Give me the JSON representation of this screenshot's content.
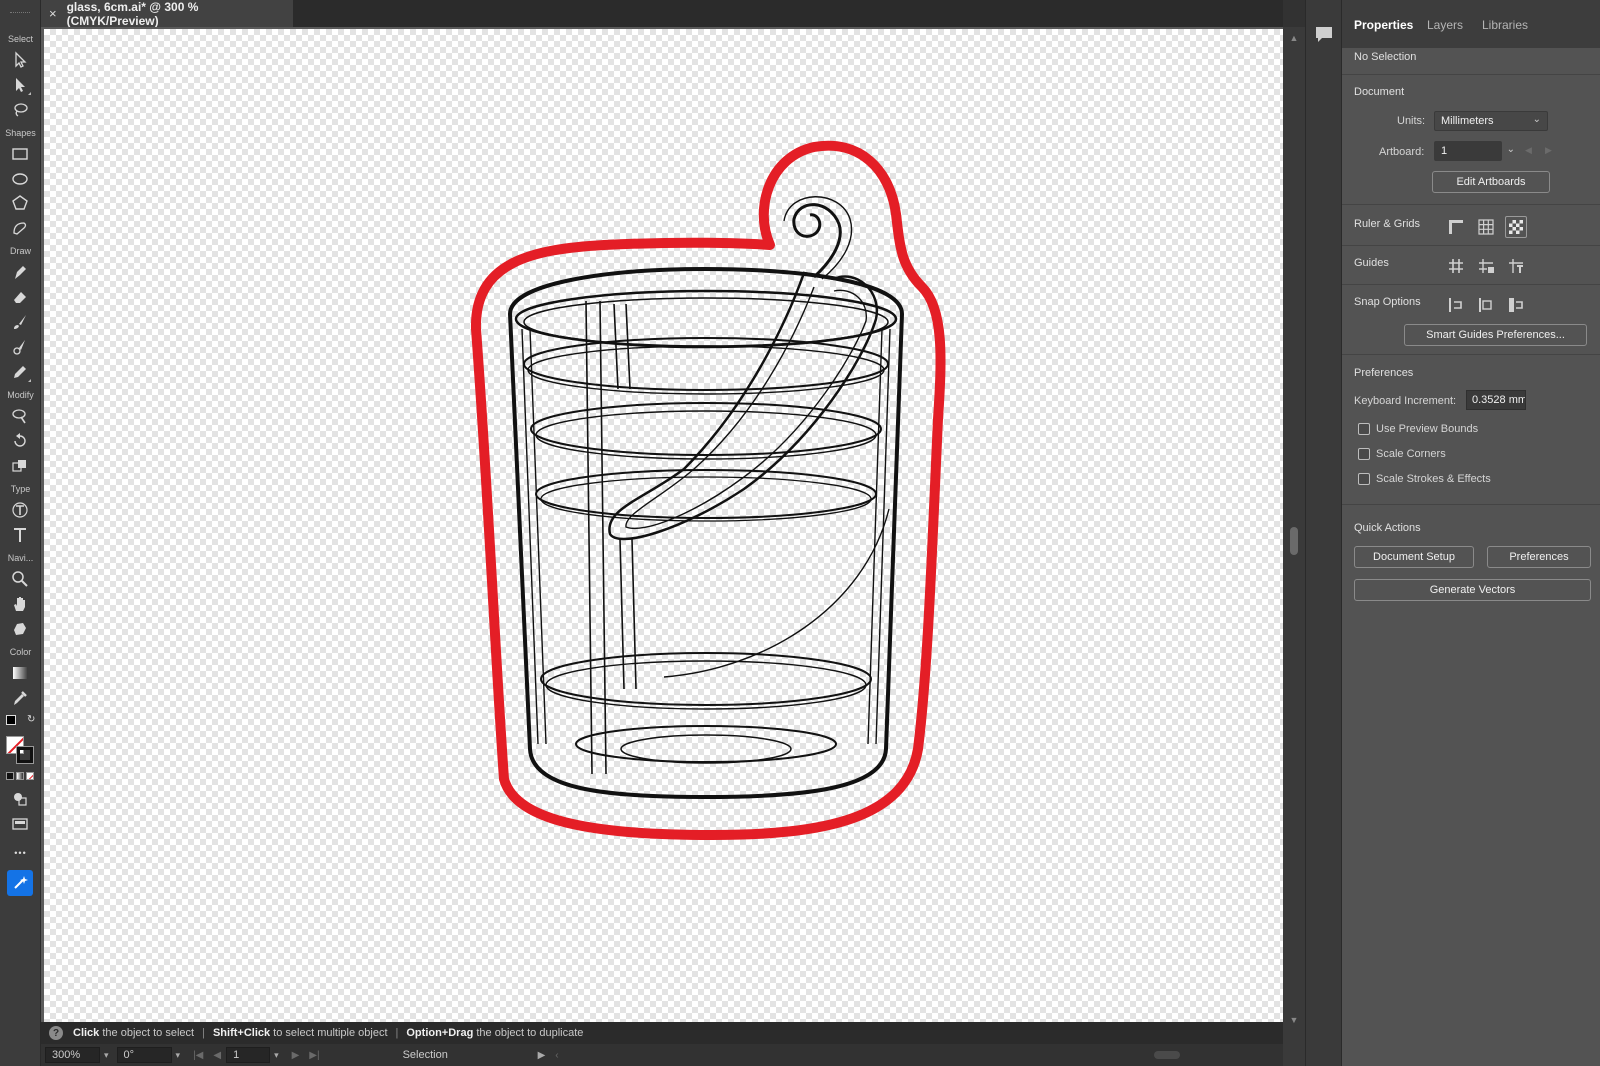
{
  "document_tab": {
    "title": "glass, 6cm.ai* @ 300 % (CMYK/Preview)",
    "close": "×"
  },
  "toolbar": {
    "sections": {
      "select": "Select",
      "shapes": "Shapes",
      "draw": "Draw",
      "modify": "Modify",
      "type": "Type",
      "navigate": "Navi...",
      "color": "Color"
    },
    "more": "•••"
  },
  "hint": {
    "icon": "?",
    "k1": "Click",
    "t1": "the object to select",
    "k2": "Shift+Click",
    "t2": "to select multiple object",
    "k3": "Option+Drag",
    "t3": "the object to duplicate"
  },
  "status": {
    "zoom": "300%",
    "rotation": "0°",
    "artboard": "1",
    "tool": "Selection"
  },
  "panel": {
    "tabs": [
      "Properties",
      "Layers",
      "Libraries"
    ],
    "selection": "No Selection",
    "document": {
      "heading": "Document",
      "units_label": "Units:",
      "units_value": "Millimeters",
      "artboard_label": "Artboard:",
      "artboard_value": "1",
      "edit_artboards": "Edit Artboards"
    },
    "ruler_grids": "Ruler & Grids",
    "guides": "Guides",
    "snap_options": "Snap Options",
    "smart_guides_button": "Smart Guides Preferences...",
    "preferences": {
      "heading": "Preferences",
      "keyboard_increment_label": "Keyboard Increment:",
      "keyboard_increment_value": "0.3528 mm",
      "use_preview_bounds": "Use Preview Bounds",
      "scale_corners": "Scale Corners",
      "scale_strokes": "Scale Strokes & Effects"
    },
    "quick_actions": {
      "heading": "Quick Actions",
      "document_setup": "Document Setup",
      "preferences": "Preferences",
      "generate_vectors": "Generate Vectors"
    }
  },
  "colors": {
    "accent": "#1473e6",
    "cutline": "#e41e26",
    "panel_bg": "#535353"
  }
}
